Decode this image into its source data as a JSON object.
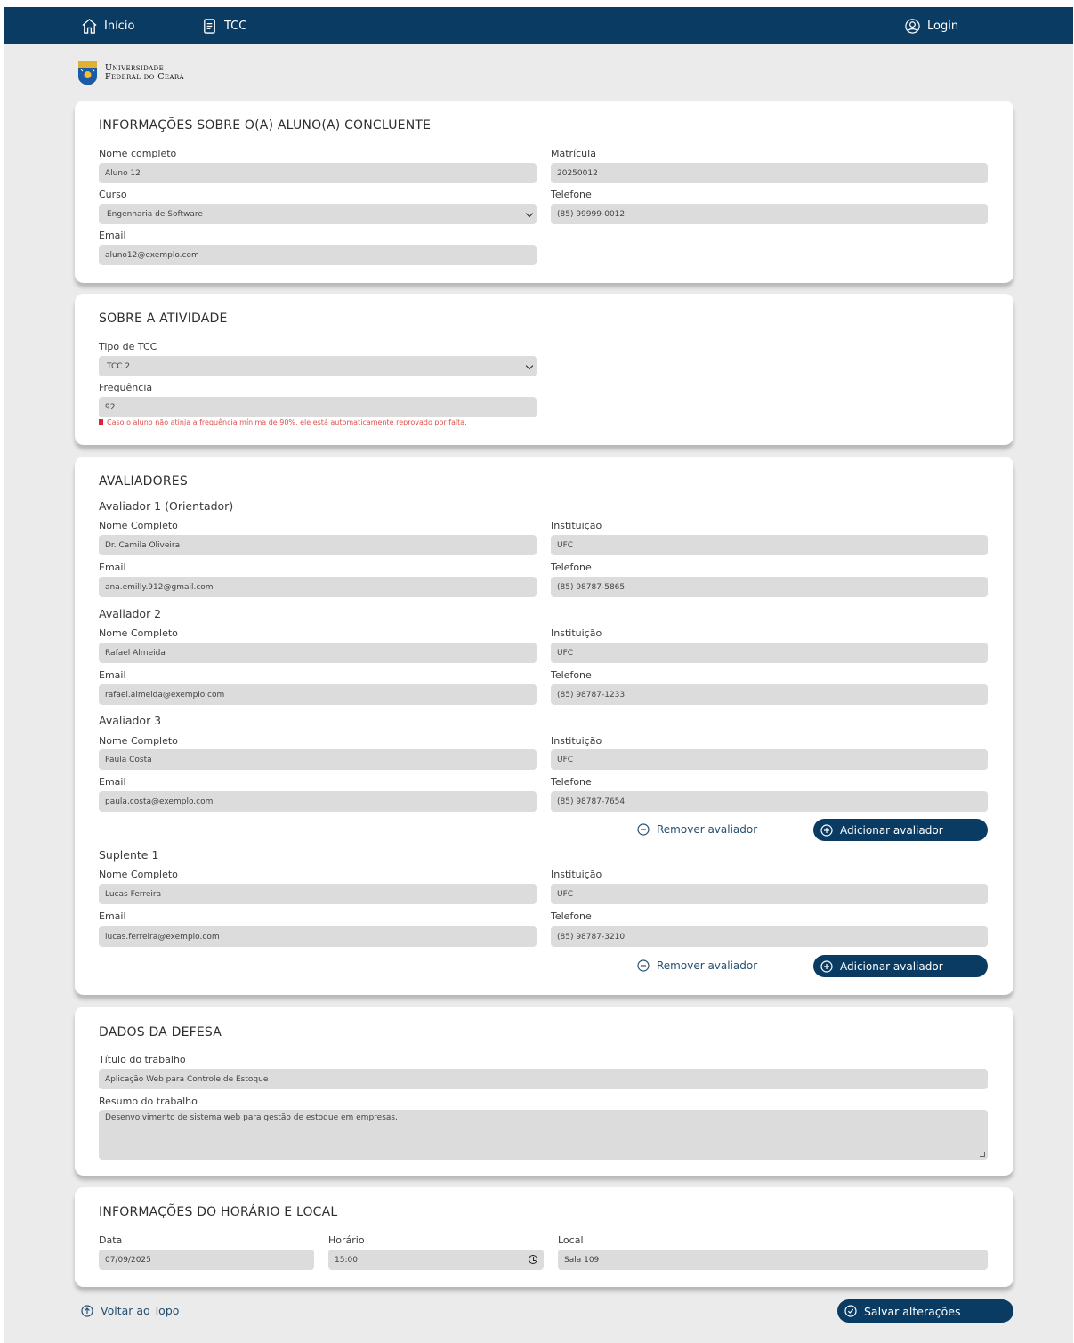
{
  "nav": {
    "home": "Início",
    "tcc": "TCC",
    "login": "Login"
  },
  "logo": {
    "line1": "Universidade",
    "line2": "Federal do Ceará"
  },
  "aluno": {
    "title": "INFORMAÇÕES SOBRE O(A) ALUNO(A) CONCLUENTE",
    "nome_label": "Nome completo",
    "nome": "Aluno 12",
    "matricula_label": "Matrícula",
    "matricula": "20250012",
    "curso_label": "Curso",
    "curso": "Engenharia de Software",
    "telefone_label": "Telefone",
    "telefone": "(85) 99999-0012",
    "email_label": "Email",
    "email": "aluno12@exemplo.com"
  },
  "atividade": {
    "title": "SOBRE A ATIVIDADE",
    "tipo_label": "Tipo de TCC",
    "tipo": "TCC 2",
    "freq_label": "Frequência",
    "freq": "92",
    "warning": "Caso o aluno não atinja a frequência mínima de 90%, ele está automaticamente reprovado por falta."
  },
  "avaliadores": {
    "title": "AVALIADORES",
    "labels": {
      "nome": "Nome Completo",
      "instituicao": "Instituição",
      "email": "Email",
      "telefone": "Telefone"
    },
    "items": [
      {
        "heading": "Avaliador 1 (Orientador)",
        "nome": "Dr. Camila Oliveira",
        "instituicao": "UFC",
        "email": "ana.emilly.912@gmail.com",
        "telefone": "(85) 98787-5865"
      },
      {
        "heading": "Avaliador 2",
        "nome": "Rafael Almeida",
        "instituicao": "UFC",
        "email": "rafael.almeida@exemplo.com",
        "telefone": "(85) 98787-1233"
      },
      {
        "heading": "Avaliador 3",
        "nome": "Paula Costa",
        "instituicao": "UFC",
        "email": "paula.costa@exemplo.com",
        "telefone": "(85) 98787-7654"
      },
      {
        "heading": "Suplente 1",
        "nome": "Lucas Ferreira",
        "instituicao": "UFC",
        "email": "lucas.ferreira@exemplo.com",
        "telefone": "(85) 98787-3210"
      }
    ],
    "remove_label": "Remover avaliador",
    "add_label": "Adicionar avaliador"
  },
  "defesa": {
    "title": "DADOS DA DEFESA",
    "titulo_label": "Título do trabalho",
    "titulo": "Aplicação Web para Controle de Estoque",
    "resumo_label": "Resumo do trabalho",
    "resumo": "Desenvolvimento de sistema web para gestão de estoque em empresas."
  },
  "horario": {
    "title": "INFORMAÇÕES DO HORÁRIO E LOCAL",
    "data_label": "Data",
    "data": "07/09/2025",
    "hora_label": "Horário",
    "hora": "15:00",
    "local_label": "Local",
    "local": "Sala 109"
  },
  "footer": {
    "top_label": "Voltar ao Topo",
    "save_label": "Salvar alterações"
  },
  "colors": {
    "navbar": "#0a3b63",
    "background": "#ebebeb",
    "field": "#dcdcdc",
    "warning": "#e0504e"
  }
}
